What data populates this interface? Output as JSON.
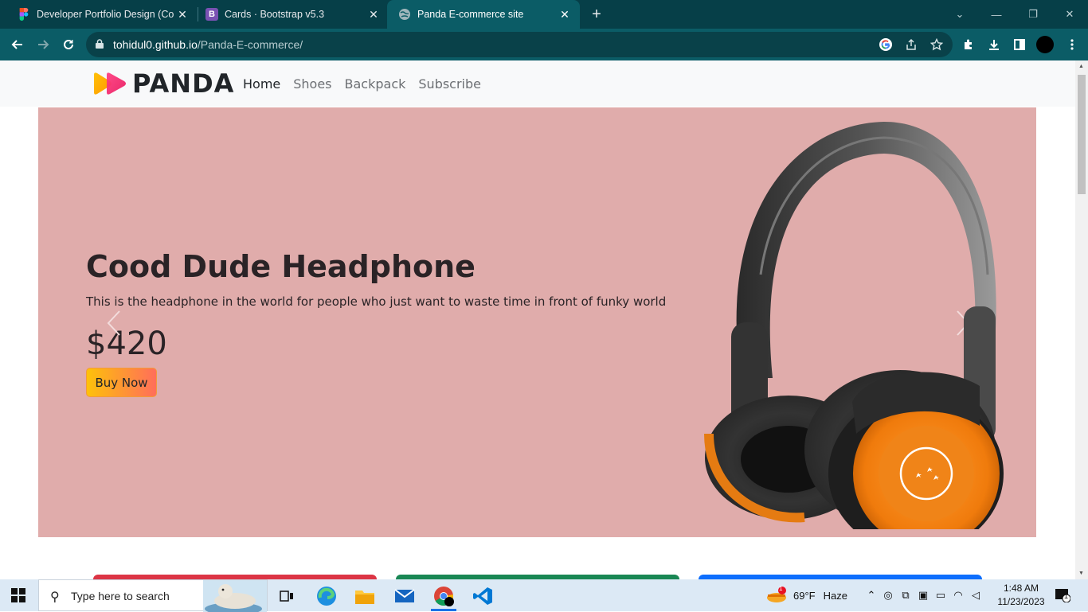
{
  "browser": {
    "tabs": [
      {
        "title": "Developer Portfolio Design (Con",
        "close": "✕",
        "favicon": "figma-icon"
      },
      {
        "title": "Cards · Bootstrap v5.3",
        "close": "✕",
        "favicon": "bootstrap-icon",
        "favicon_letter": "B"
      },
      {
        "title": "Panda E-commerce site",
        "close": "✕",
        "favicon": "globe-icon",
        "active": true
      }
    ],
    "new_tab": "+",
    "window_controls": {
      "collapse": "⌄",
      "minimize": "—",
      "restore": "❐",
      "close": "✕"
    },
    "url_host": "tohidul0.github.io",
    "url_path": "/Panda-E-commerce/"
  },
  "site": {
    "brand": "PANDA",
    "nav": {
      "home": "Home",
      "shoes": "Shoes",
      "backpack": "Backpack",
      "subscribe": "Subscribe"
    },
    "hero": {
      "title": "Cood Dude Headphone",
      "description": "This is the headphone in the world for people who just want to waste time in front of funky world",
      "price": "$420",
      "button": "Buy Now"
    },
    "card_colors": [
      "#dc3545",
      "#198754",
      "#0d6efd"
    ],
    "hero_background": "#e0acab"
  },
  "taskbar": {
    "search_placeholder": "Type here to search",
    "weather_temp": "69°F",
    "weather_desc": "Haze",
    "weather_badge": "1",
    "time": "1:48 AM",
    "date": "11/23/2023",
    "notification_count": "1"
  }
}
